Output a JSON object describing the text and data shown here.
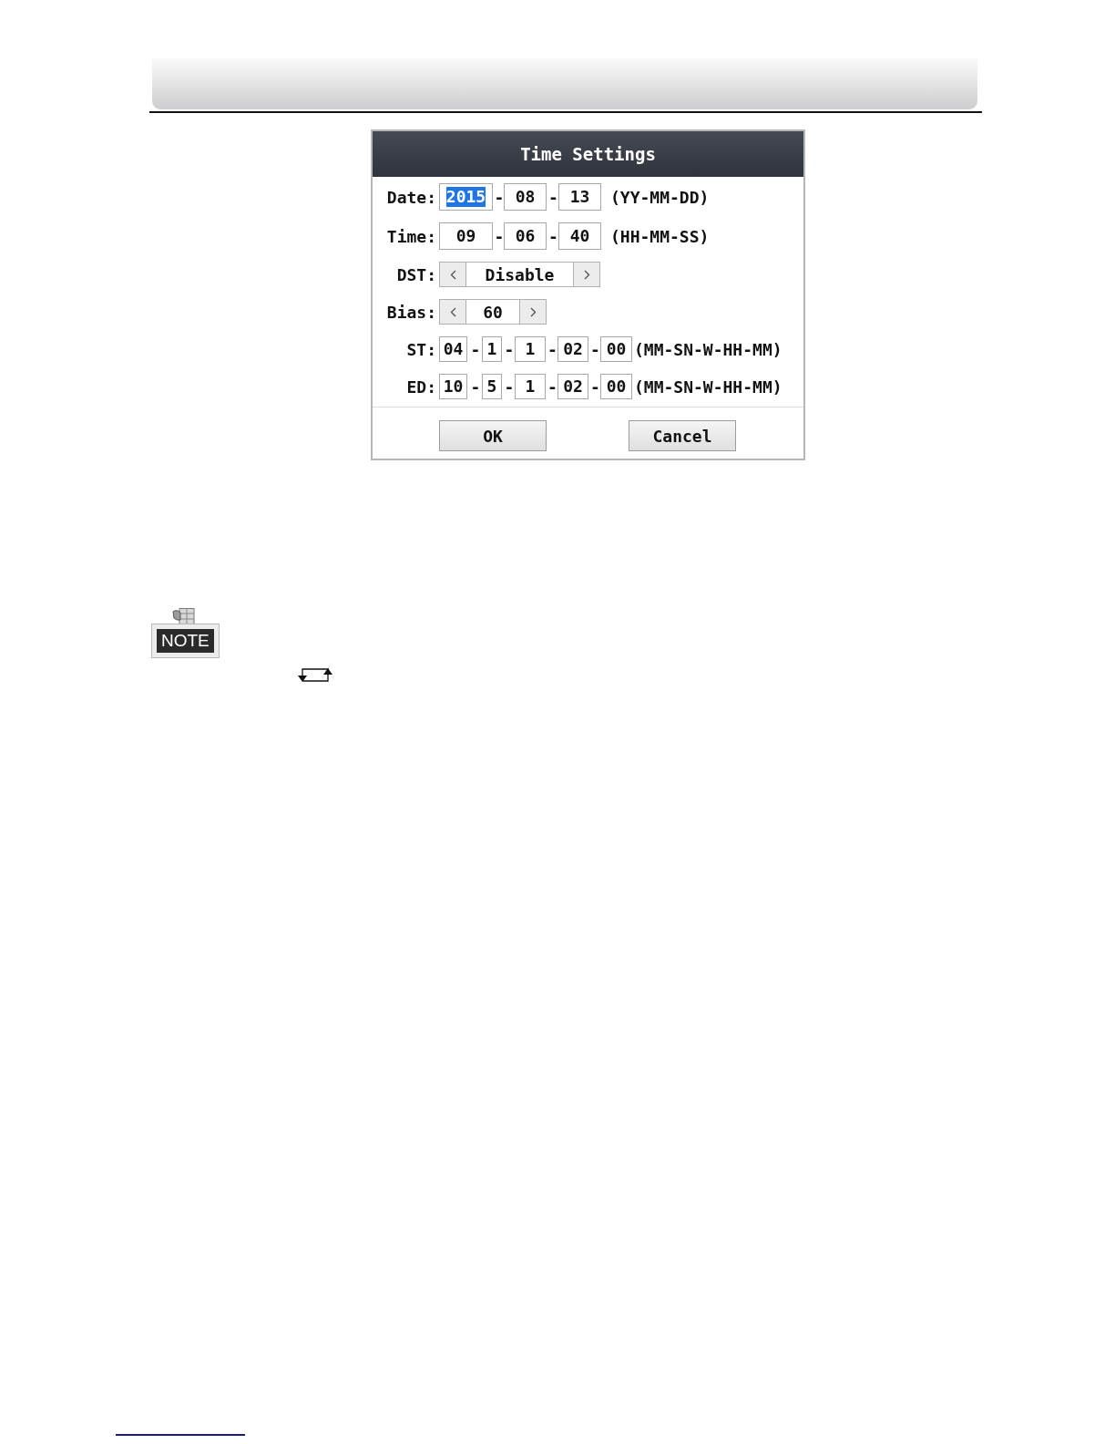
{
  "dialog": {
    "title": "Time Settings",
    "rows": [
      {
        "kind": "fields",
        "label": "Date:",
        "parts": [
          {
            "kind": "field",
            "value": "2015",
            "selected": true
          },
          {
            "kind": "separator",
            "text": "-"
          },
          {
            "kind": "field",
            "value": "08",
            "selected": false
          },
          {
            "kind": "separator",
            "text": "-"
          },
          {
            "kind": "field",
            "value": "13",
            "selected": false
          }
        ],
        "hint": "(YY-MM-DD)"
      },
      {
        "kind": "fields",
        "label": "Time:",
        "parts": [
          {
            "kind": "field",
            "value": "09",
            "selected": false
          },
          {
            "kind": "separator",
            "text": "-"
          },
          {
            "kind": "field",
            "value": "06",
            "selected": false
          },
          {
            "kind": "separator",
            "text": "-"
          },
          {
            "kind": "field",
            "value": "40",
            "selected": false
          }
        ],
        "hint": "(HH-MM-SS)"
      },
      {
        "kind": "spinner",
        "label": "DST:",
        "value": "Disable"
      },
      {
        "kind": "spinner",
        "label": "Bias:",
        "value": "60"
      },
      {
        "kind": "fields",
        "label": "ST:",
        "parts": [
          {
            "kind": "field",
            "value": "04",
            "selected": false
          },
          {
            "kind": "separator",
            "text": "-"
          },
          {
            "kind": "field",
            "value": "1",
            "selected": false
          },
          {
            "kind": "separator",
            "text": "-"
          },
          {
            "kind": "field",
            "value": "1",
            "selected": false
          },
          {
            "kind": "separator",
            "text": "-"
          },
          {
            "kind": "field",
            "value": "02",
            "selected": false
          },
          {
            "kind": "separator",
            "text": "-"
          },
          {
            "kind": "field",
            "value": "00",
            "selected": false
          }
        ],
        "hint": "(MM-SN-W-HH-MM)"
      },
      {
        "kind": "fields",
        "label": "ED:",
        "parts": [
          {
            "kind": "field",
            "value": "10",
            "selected": false
          },
          {
            "kind": "separator",
            "text": "-"
          },
          {
            "kind": "field",
            "value": "5",
            "selected": false
          },
          {
            "kind": "separator",
            "text": "-"
          },
          {
            "kind": "field",
            "value": "1",
            "selected": false
          },
          {
            "kind": "separator",
            "text": "-"
          },
          {
            "kind": "field",
            "value": "02",
            "selected": false
          },
          {
            "kind": "separator",
            "text": "-"
          },
          {
            "kind": "field",
            "value": "00",
            "selected": false
          }
        ],
        "hint": "(MM-SN-W-HH-MM)"
      }
    ],
    "buttons": [
      "OK",
      "Cancel"
    ]
  },
  "note": {
    "label": "NOTE"
  }
}
